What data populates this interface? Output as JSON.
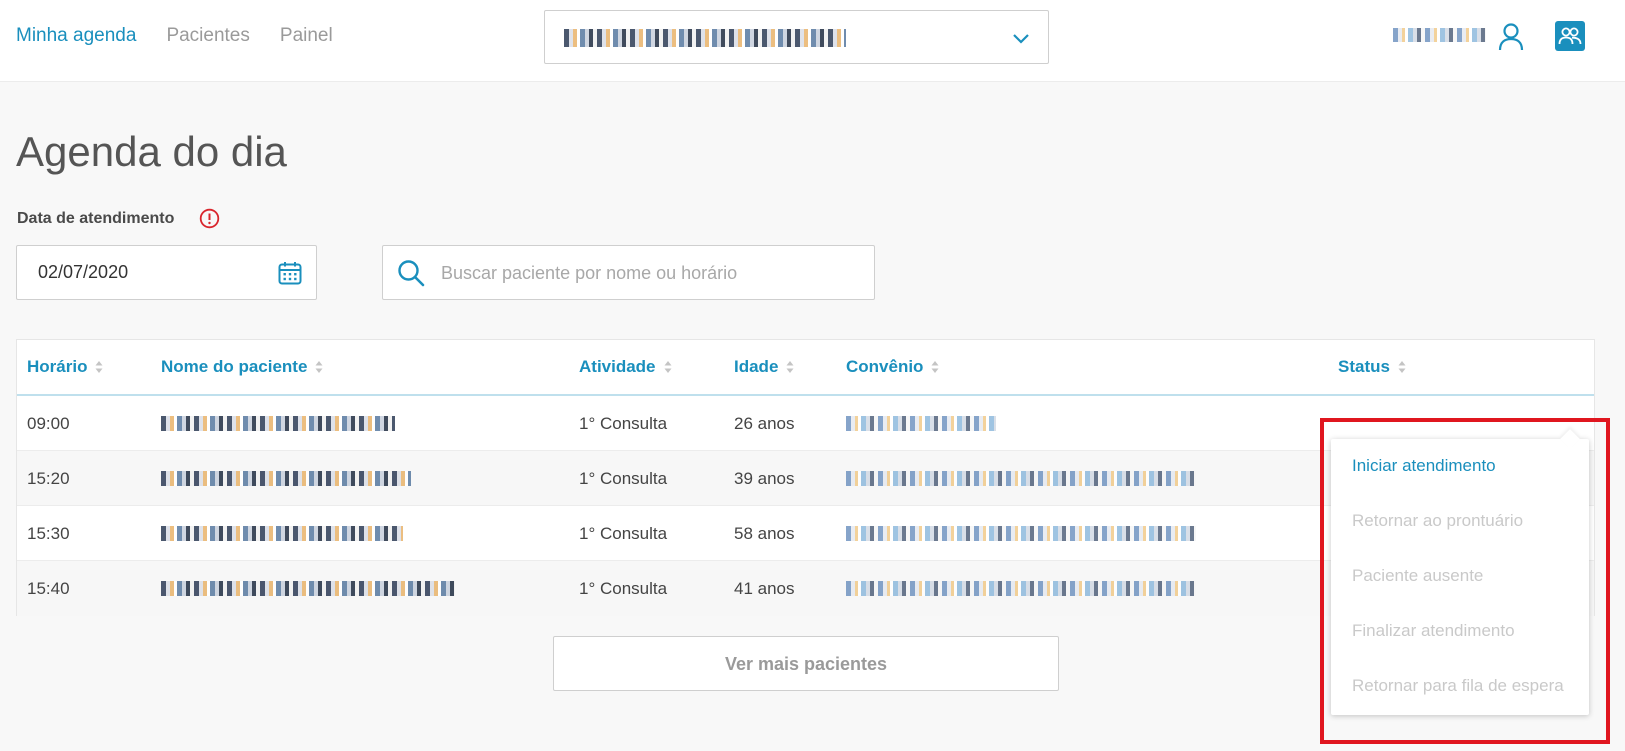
{
  "nav": {
    "items": [
      {
        "label": "Minha agenda",
        "active": true
      },
      {
        "label": "Pacientes",
        "active": false
      },
      {
        "label": "Painel",
        "active": false
      }
    ]
  },
  "header": {
    "unit_selector_icon": "chevron-down-icon",
    "user_icon": "user-icon",
    "patients_icon": "patients-icon"
  },
  "page": {
    "title": "Agenda do dia",
    "date_label": "Data de atendimento",
    "date_value": "02/07/2020",
    "search_placeholder": "Buscar paciente por nome ou horário"
  },
  "table": {
    "columns": [
      "Horário",
      "Nome do paciente",
      "Atividade",
      "Idade",
      "Convênio",
      "Status"
    ],
    "rows": [
      {
        "time": "09:00",
        "activity": "1° Consulta",
        "age": "26 anos"
      },
      {
        "time": "15:20",
        "activity": "1° Consulta",
        "age": "39 anos"
      },
      {
        "time": "15:30",
        "activity": "1° Consulta",
        "age": "58 anos"
      },
      {
        "time": "15:40",
        "activity": "1° Consulta",
        "age": "41 anos"
      }
    ]
  },
  "more_button": "Ver mais pacientes",
  "status_menu": {
    "items": [
      {
        "label": "Iniciar atendimento",
        "enabled": true
      },
      {
        "label": "Retornar ao prontuário",
        "enabled": false
      },
      {
        "label": "Paciente ausente",
        "enabled": false
      },
      {
        "label": "Finalizar atendimento",
        "enabled": false
      },
      {
        "label": "Retornar para fila de espera",
        "enabled": false
      }
    ]
  },
  "colors": {
    "accent": "#1a8fbd",
    "alert": "#d9262d",
    "highlight": "#e0161f",
    "disabled_text": "#c9c9c9"
  }
}
